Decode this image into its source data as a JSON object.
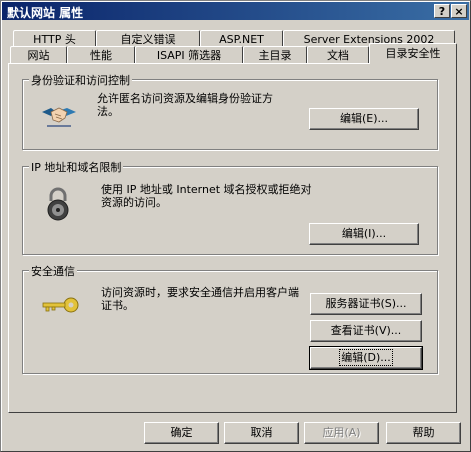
{
  "window": {
    "title": "默认网站 属性",
    "help_button": "?",
    "close_button": "×"
  },
  "tabs_row1": [
    "HTTP 头",
    "自定义错误",
    "ASP.NET",
    "Server Extensions 2002"
  ],
  "tabs_row2": [
    "网站",
    "性能",
    "ISAPI 筛选器",
    "主目录",
    "文档",
    "目录安全性"
  ],
  "groups": {
    "auth": {
      "title": "身份验证和访问控制",
      "description": "允许匿名访问资源及编辑身份验证方法。",
      "edit_button": "编辑(E)..."
    },
    "ip": {
      "title": "IP 地址和域名限制",
      "description": "使用 IP 地址或 Internet 域名授权或拒绝对资源的访问。",
      "edit_button": "编辑(I)..."
    },
    "secure": {
      "title": "安全通信",
      "description": "访问资源时，要求安全通信并启用客户端证书。",
      "server_cert_button": "服务器证书(S)...",
      "view_cert_button": "查看证书(V)...",
      "edit_button": "编辑(D)..."
    }
  },
  "footer": {
    "ok": "确定",
    "cancel": "取消",
    "apply": "应用(A)",
    "help": "帮助"
  }
}
